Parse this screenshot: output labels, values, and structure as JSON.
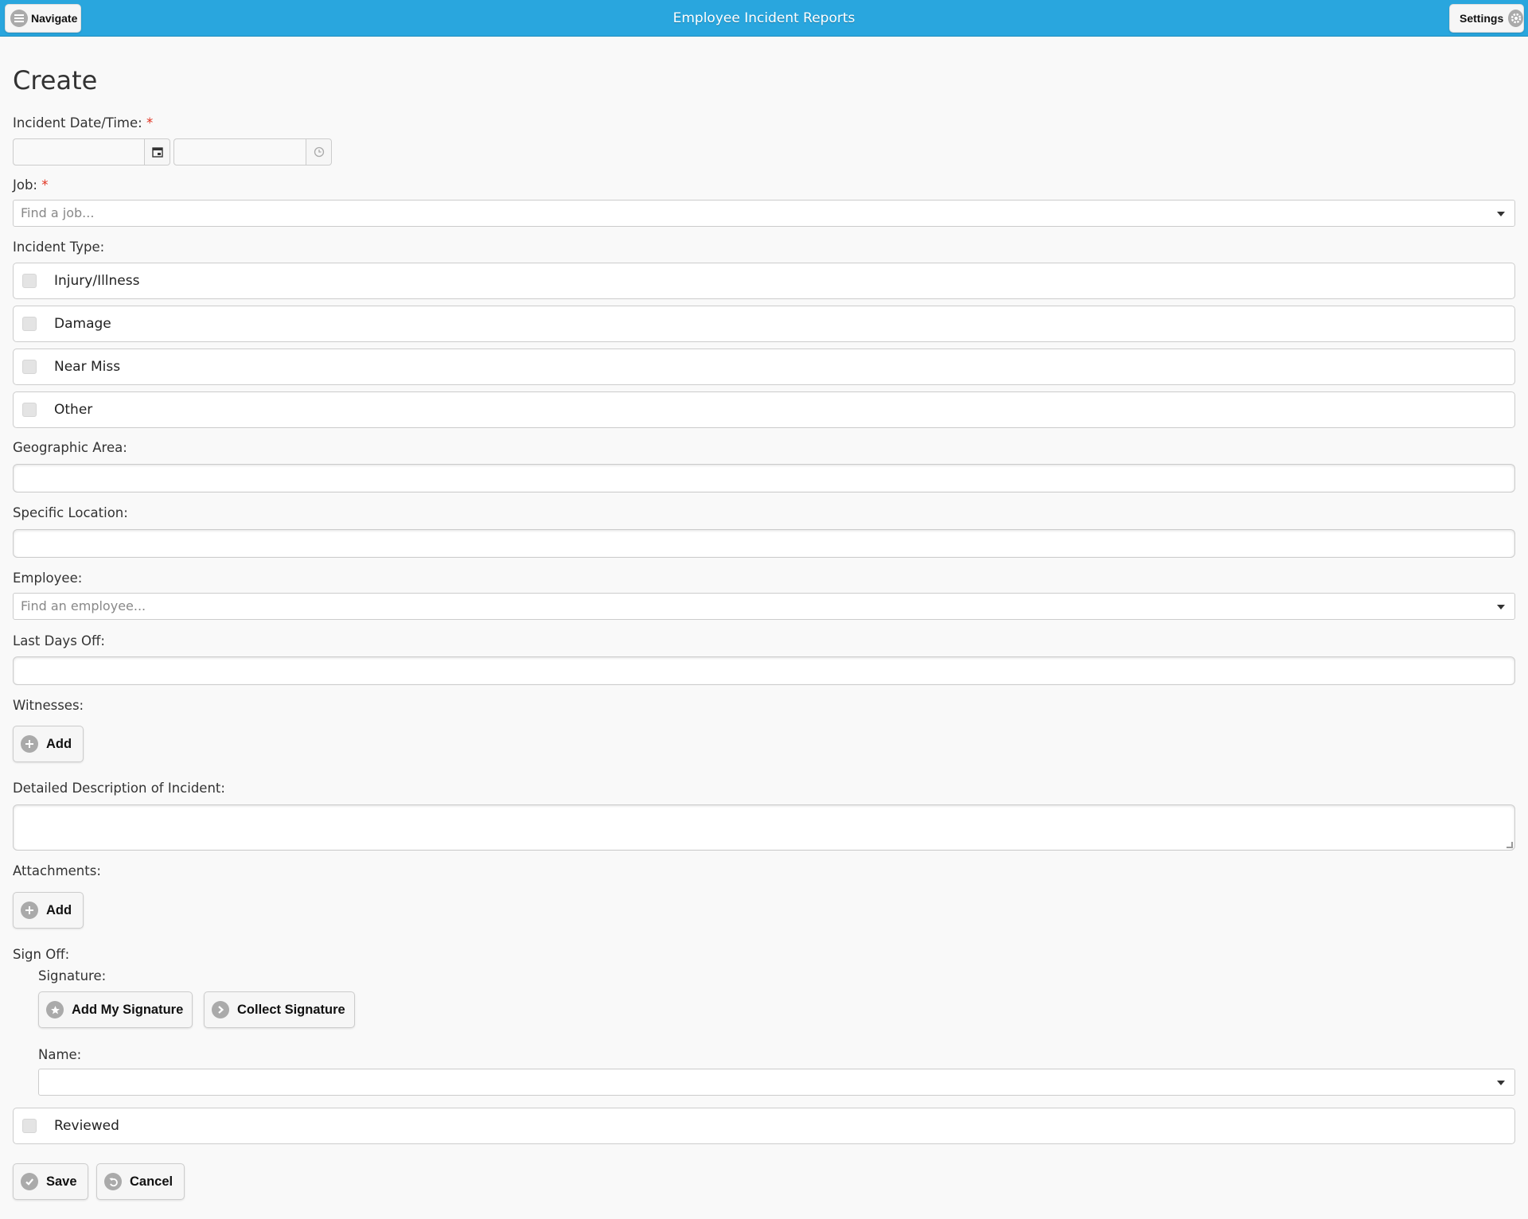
{
  "header": {
    "title": "Employee Incident Reports",
    "navigate_label": "Navigate",
    "settings_label": "Settings"
  },
  "page": {
    "title": "Create"
  },
  "form": {
    "incident_datetime": {
      "label": "Incident Date/Time:",
      "required_mark": "*"
    },
    "job": {
      "label": "Job:",
      "required_mark": "*",
      "placeholder": "Find a job..."
    },
    "incident_type": {
      "label": "Incident Type:",
      "options": [
        {
          "label": "Injury/Illness",
          "checked": false
        },
        {
          "label": "Damage",
          "checked": false
        },
        {
          "label": "Near Miss",
          "checked": false
        },
        {
          "label": "Other",
          "checked": false
        }
      ]
    },
    "geographic_area": {
      "label": "Geographic Area:",
      "value": ""
    },
    "specific_location": {
      "label": "Specific Location:",
      "value": ""
    },
    "employee": {
      "label": "Employee:",
      "placeholder": "Find an employee..."
    },
    "last_days_off": {
      "label": "Last Days Off:",
      "value": ""
    },
    "witnesses": {
      "label": "Witnesses:",
      "add_label": "Add"
    },
    "description": {
      "label": "Detailed Description of Incident:",
      "value": ""
    },
    "attachments": {
      "label": "Attachments:",
      "add_label": "Add"
    },
    "sign_off": {
      "label": "Sign Off:",
      "signature_label": "Signature:",
      "add_my_signature": "Add My Signature",
      "collect_signature": "Collect Signature",
      "name_label": "Name:",
      "name_value": ""
    },
    "reviewed": {
      "label": "Reviewed",
      "checked": false
    }
  },
  "actions": {
    "save_label": "Save",
    "cancel_label": "Cancel"
  }
}
